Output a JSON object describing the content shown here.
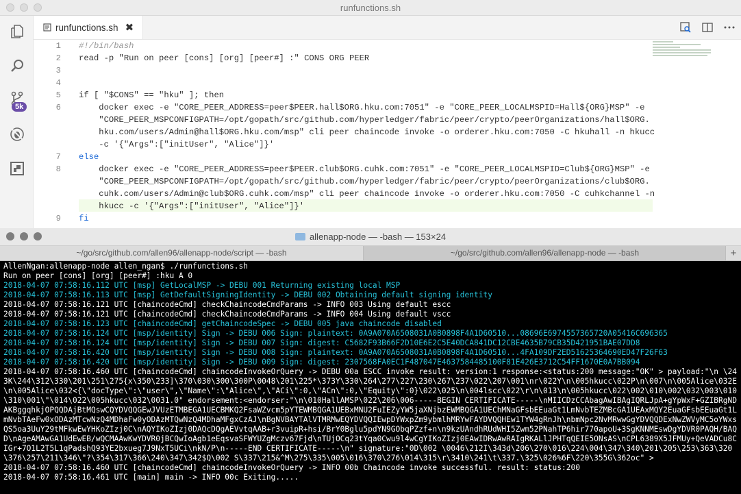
{
  "editor": {
    "window_title": "runfunctions.sh",
    "tab_label": "runfunctions.sh",
    "tab_close": "✖",
    "git_badge": "5k",
    "lines": [
      {
        "n": "1",
        "text": "#!/bin/bash"
      },
      {
        "n": "2",
        "text": "read -p \"Run on peer [cons] [org] [peer#] :\" CONS ORG PEER"
      },
      {
        "n": "3",
        "text": ""
      },
      {
        "n": "4",
        "text": ""
      },
      {
        "n": "5",
        "text": "if [ \"$CONS\" == \"hku\" ]; then"
      },
      {
        "n": "6",
        "text": "    docker exec -e \"CORE_PEER_ADDRESS=peer$PEER.hall$ORG.hku.com:7051\" -e \"CORE_PEER_LOCALMSPID=Hall${ORG}MSP\" -e"
      },
      {
        "n": "",
        "text": "    \"CORE_PEER_MSPCONFIGPATH=/opt/gopath/src/github.com/hyperledger/fabric/peer/crypto/peerOrganizations/hall$ORG."
      },
      {
        "n": "",
        "text": "    hku.com/users/Admin@hall$ORG.hku.com/msp\" cli peer chaincode invoke -o orderer.hku.com:7050 -C hkuhall -n hkucc"
      },
      {
        "n": "",
        "text": "    -c '{\"Args\":[\"initUser\", \"Alice\"]}'"
      },
      {
        "n": "7",
        "text": "else"
      },
      {
        "n": "8",
        "text": "    docker exec -e \"CORE_PEER_ADDRESS=peer$PEER.club$ORG.cuhk.com:7051\" -e \"CORE_PEER_LOCALMSPID=Club${ORG}MSP\" -e"
      },
      {
        "n": "",
        "text": "    \"CORE_PEER_MSPCONFIGPATH=/opt/gopath/src/github.com/hyperledger/fabric/peer/crypto/peerOrganizations/club$ORG."
      },
      {
        "n": "",
        "text": "    cuhk.com/users/Admin@club$ORG.cuhk.com/msp\" cli peer chaincode invoke -o orderer.hku.com:7050 -C cuhkchannel -n"
      },
      {
        "n": "",
        "text": "    hkucc -c '{\"Args\":[\"initUser\", \"Alice\"]}'"
      },
      {
        "n": "9",
        "text": "fi"
      }
    ]
  },
  "terminal": {
    "window_title": "allenapp-node — -bash — 153×24",
    "tabs": [
      "~/go/src/github.com/allen96/allenapp-node/script — -bash",
      "~/go/src/github.com/allen96/allenapp-node — -bash"
    ],
    "plus": "+",
    "lines": [
      {
        "text": "AllenNgan:allenapp-node allen_ngan$ ./runfunctions.sh",
        "color": "white"
      },
      {
        "text": "Run on peer [cons] [org] [peer#] :hku A 0",
        "color": "white"
      },
      {
        "text": "2018-04-07 07:58:16.112 UTC [msp] GetLocalMSP -> DEBU 001 Returning existing local MSP",
        "color": "cyan"
      },
      {
        "text": "2018-04-07 07:58:16.113 UTC [msp] GetDefaultSigningIdentity -> DEBU 002 Obtaining default signing identity",
        "color": "cyan"
      },
      {
        "text": "2018-04-07 07:58:16.121 UTC [chaincodeCmd] checkChaincodeCmdParams -> INFO 003 Using default escc",
        "color": "white"
      },
      {
        "text": "2018-04-07 07:58:16.121 UTC [chaincodeCmd] checkChaincodeCmdParams -> INFO 004 Using default vscc",
        "color": "white"
      },
      {
        "text": "2018-04-07 07:58:16.123 UTC [chaincodeCmd] getChaincodeSpec -> DEBU 005 java chaincode disabled",
        "color": "cyan"
      },
      {
        "text": "2018-04-07 07:58:16.124 UTC [msp/identity] Sign -> DEBU 006 Sign: plaintext: 0A9A070A6508031A0B0898F4A1D60510...08696E6974557365720A05416C696365",
        "color": "cyan"
      },
      {
        "text": "2018-04-07 07:58:16.124 UTC [msp/identity] Sign -> DEBU 007 Sign: digest: C5682F93B66F2D10E6E2C5E40DCA841DC12CBE4635B79CB35D421951BAE07DD8",
        "color": "cyan"
      },
      {
        "text": "2018-04-07 07:58:16.420 UTC [msp/identity] Sign -> DEBU 008 Sign: plaintext: 0A9A070A6508031A0B0898F4A1D60510...4FA109DF2ED51625364690ED47F26F63",
        "color": "cyan"
      },
      {
        "text": "2018-04-07 07:58:16.420 UTC [msp/identity] Sign -> DEBU 009 Sign: digest: 2307568FA0EC1F487047E4637584485100F81E426E3712C54FF1670E0A7BB094",
        "color": "cyan"
      },
      {
        "text": "2018-04-07 07:58:16.460 UTC [chaincodeCmd] chaincodeInvokeOrQuery -> DEBU 00a ESCC invoke result: version:1 response:<status:200 message:\"OK\" > payload:\"\\n \\243K\\244\\312\\330\\201\\251\\275{x\\350\\233]\\370\\030\\300\\300P\\0048\\201\\225*\\373Y\\330\\264\\277\\227\\230\\267\\237\\022\\207\\001\\nr\\022Y\\n\\005hkucc\\022P\\n\\007\\n\\005Alice\\032E\\n\\005Alice\\032<{\\\"docType\\\":\\\"user\\\",\\\"Name\\\":\\\"Alice\\\",\\\"ACi\\\":0,\\\"ACn\\\":0,\\\"Equity\\\":0}\\022\\025\\n\\004lscc\\022\\r\\n\\013\\n\\005hkucc\\022\\002\\010\\002\\032\\003\\010\\310\\001\\\"\\014\\022\\005hkucc\\032\\0031.0\" endorsement:<endorser:\"\\n\\010HallAMSP\\022\\206\\006-----BEGIN CERTIFICATE-----\\nMIICDzCCAbagAwIBAgIQRLJpA+gYpWxF+GZIBRgNDAKBggqhkjOPQQDAjBtMQswCQYDVQQGEwJVUzETMBEGA1UECBMKQ2FsaWZvcm5pYTEWMBQGA1UEBxMNU2FuIEZyYW5jaXNjbzEWMBQGA1UEChMNaGFsbEEuaGt1LmNvbTEZMBcGA1UEAxMQY2EuaGFsbEEuaGt1LmNvbTAeFw0xODAzMTcwNzQ4MDhaFw0yODAzMTQwNzQ4MDhaMFgxCzAJ\\nBgNVBAYTAlVTMRMwEQYDVQQIEwpDYWxpZm9ybmlhMRYwFAYDVQQHEw1TYW4gRnJh\\nbmNpc2NvMRwwGgYDVQQDExNwZWVyMC5oYWxsQS5oa3UuY29tMFkwEwYHKoZIzj0C\\nAQYIKoZIzj0DAQcDQgAEVvtqAAB+r3vuipR+hsi/BrY0Bglu5pdYN9GObqPZzf+n\\n9kzUAndhRUdWHI5Zwm52PNahTP6hir770apoU+3SgKNNMEswDgYDVR0PAQH/BAQD\\nAgeAMAwGA1UdEwEB/wQCMAAwKwYDVR0jBCQwIoAgb1eEqsvaSFWYUZgMczv67Fjd\\nTUjOCq23tYqa0Cwu9l4wCgYIKoZIzj0EAwIDRwAwRAIgRKALlJPHTqQEIE5ONsAS\\nCPL6389X5JFMUy+QeVADCu8CIGr+7O1L2T5L1qPadshQ93YE2bxueg7J9NxT5UCi\\nkN/P\\n-----END CERTIFICATE-----\\n\" signature:\"0D\\002 \\0046\\212I\\343d\\206\\270\\016\\224\\004\\347\\340\\201\\205\\253\\363\\320\\376\\257\\211\\346\\\"?\\354\\317\\366\\240\\347\\342$Q\\002 S\\337\\215&^M\\275\\335\\005\\016\\370\\276\\014\\315\\r\\3410\\241\\t\\337.\\325\\026%6F\\220\\355G\\362oc\" >",
        "color": "mixed"
      },
      {
        "text": "2018-04-07 07:58:16.460 UTC [chaincodeCmd] chaincodeInvokeOrQuery -> INFO 00b Chaincode invoke successful. result: status:200",
        "color": "white"
      },
      {
        "text": "2018-04-07 07:58:16.461 UTC [main] main -> INFO 00c Exiting.....",
        "color": "white"
      }
    ]
  }
}
